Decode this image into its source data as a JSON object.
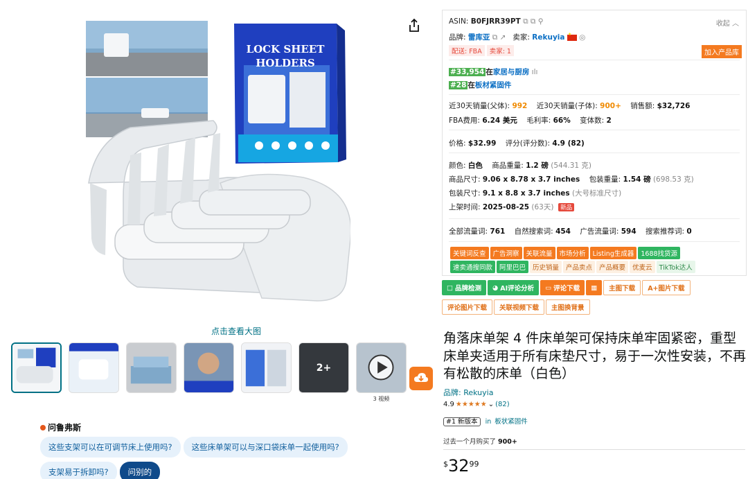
{
  "media": {
    "view_large": "点击查看大图",
    "box_title_line1": "LOCK SHEET",
    "box_title_line2": "HOLDERS",
    "more_count": "2+",
    "video_label": "3 视频"
  },
  "rufus": {
    "title": "问鲁弗斯",
    "questions": [
      "这些支架可以在可调节床上使用吗?",
      "这些床单架可以与深口袋床单一起使用吗?",
      "支架易于拆卸吗?"
    ],
    "ask_label": "问别的"
  },
  "panel": {
    "asin_label": "ASIN:",
    "asin_value": "B0FJRR39PT",
    "collapse": "收起",
    "brand_label": "品牌:",
    "brand_value": "雷库亚",
    "seller_label": "卖家:",
    "seller_value": "Rekuyia",
    "ship_tag": "配送: FBA",
    "seller_tag": "卖家: 1",
    "add_library": "加入产品库",
    "rank1_badge": "#33,954",
    "rank1_text": "在",
    "rank1_cat": "家居与厨房",
    "rank2_badge": "#28",
    "rank2_text": "在",
    "rank2_cat": "板材紧固件",
    "sales30_label": "近30天销量(父体):",
    "sales30_value": "992",
    "sales30c_label": "近30天销量(子体):",
    "sales30c_value": "900+",
    "revenue_label": "销售额:",
    "revenue_value": "$32,726",
    "fba_label": "FBA费用:",
    "fba_value": "6.24 美元",
    "margin_label": "毛利率:",
    "margin_value": "66%",
    "variants_label": "变体数:",
    "variants_value": "2",
    "price_label": "价格:",
    "price_value": "$32.99",
    "score_label": "评分(评分数):",
    "score_value": "4.9 (82)",
    "color_label": "颜色:",
    "color_value": "白色",
    "weight_label": "商品重量:",
    "weight_value": "1.2 磅",
    "weight_g": "(544.31 克)",
    "size_label": "商品尺寸:",
    "size_value": "9.06 x 8.78 x 3.7 inches",
    "pkg_weight_label": "包装重量:",
    "pkg_weight_value": "1.54 磅",
    "pkg_weight_g": "(698.53 克)",
    "pkg_size_label": "包装尺寸:",
    "pkg_size_value": "9.1 x 8.8 x 3.7 inches",
    "pkg_size_note": "(大号标准尺寸)",
    "listed_label": "上架时间:",
    "listed_value": "2025-08-25",
    "listed_days": "(63天)",
    "new_badge": "新品",
    "traffic_all_label": "全部流量词:",
    "traffic_all_value": "761",
    "organic_label": "自然搜索词:",
    "organic_value": "454",
    "ad_label": "广告流量词:",
    "ad_value": "594",
    "rec_label": "搜索推荐词:",
    "rec_value": "0",
    "tags_row1": [
      "关键词反查",
      "广告洞察",
      "关联流量",
      "市场分析",
      "Listing生成器",
      "1688找货源"
    ],
    "tags_row2": [
      "速卖通搜同款",
      "阿里巴巴",
      "历史销量",
      "产品卖点",
      "产品概要",
      "优麦云",
      "TikTok达人"
    ]
  },
  "tools": {
    "brand_check": "品牌检测",
    "ai_review": "AI评论分析",
    "review_download": "评论下载",
    "main_img_download": "主图下载",
    "aplus_download": "A+图片下载",
    "review_img_download": "评论图片下载",
    "related_video_download": "关联视频下载",
    "main_img_replace": "主图换背景"
  },
  "product": {
    "title": "角落床单架 4 件床单架可保持床单牢固紧密，重型床单夹适用于所有床垫尺寸，易于一次性安装，不再有松散的床单（白色）",
    "brand_line": "品牌: Rekuyia",
    "rating": "4.9",
    "stars": "★★★★★",
    "review_count": "(82)",
    "bestseller_badge": "#1 新版本",
    "bestseller_in": "in",
    "bestseller_cat": "板状紧固件",
    "bought_prefix": "过去一个月购买了",
    "bought_value": "900+",
    "price_currency": "$",
    "price_whole": "32",
    "price_cents": "99"
  },
  "colors": {
    "amazon_orange": "#f47a20",
    "link_teal": "#007185",
    "rank_green": "#4caf50",
    "star_orange": "#de7921",
    "box_blue": "#1f3fbf"
  }
}
